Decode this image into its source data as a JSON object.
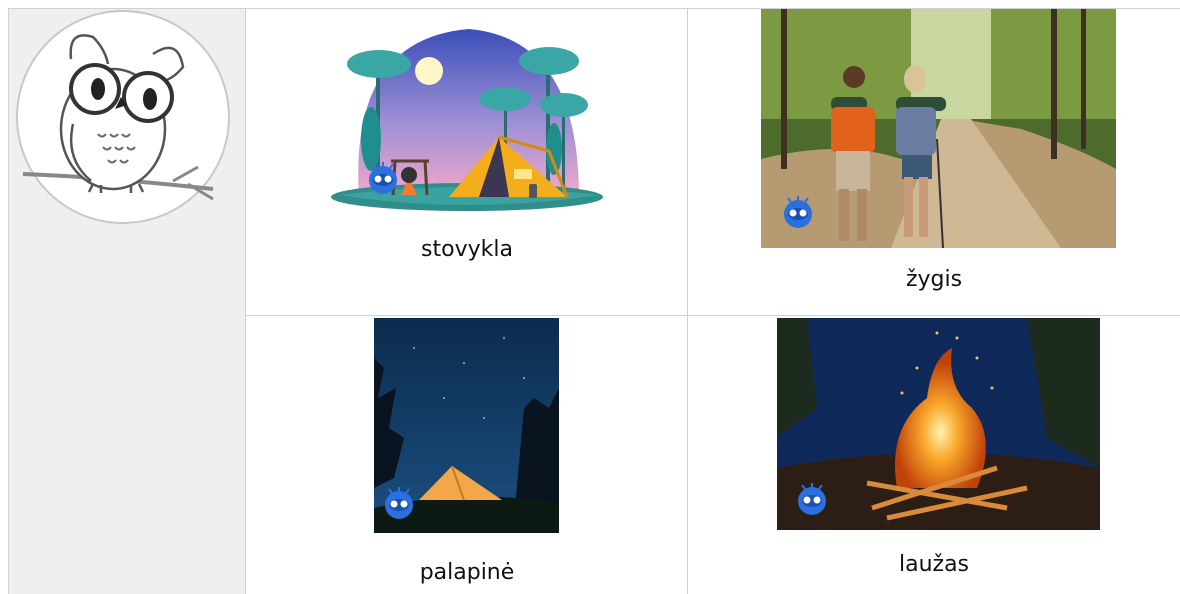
{
  "cards": [
    {
      "id": "stovykla",
      "label": "stovykla",
      "image": "camp-illustration"
    },
    {
      "id": "zygis",
      "label": "žygis",
      "image": "hikers-photo"
    },
    {
      "id": "palapine",
      "label": "palapinė",
      "image": "tent-night-photo"
    },
    {
      "id": "lauzas",
      "label": "laužas",
      "image": "campfire-photo"
    }
  ],
  "sidebar": {
    "image": "owl-drawing"
  },
  "colors": {
    "grid_line": "#d0d0d4",
    "sidebar_bg": "#efeff1",
    "robot_badge": "#2b6fe0"
  }
}
